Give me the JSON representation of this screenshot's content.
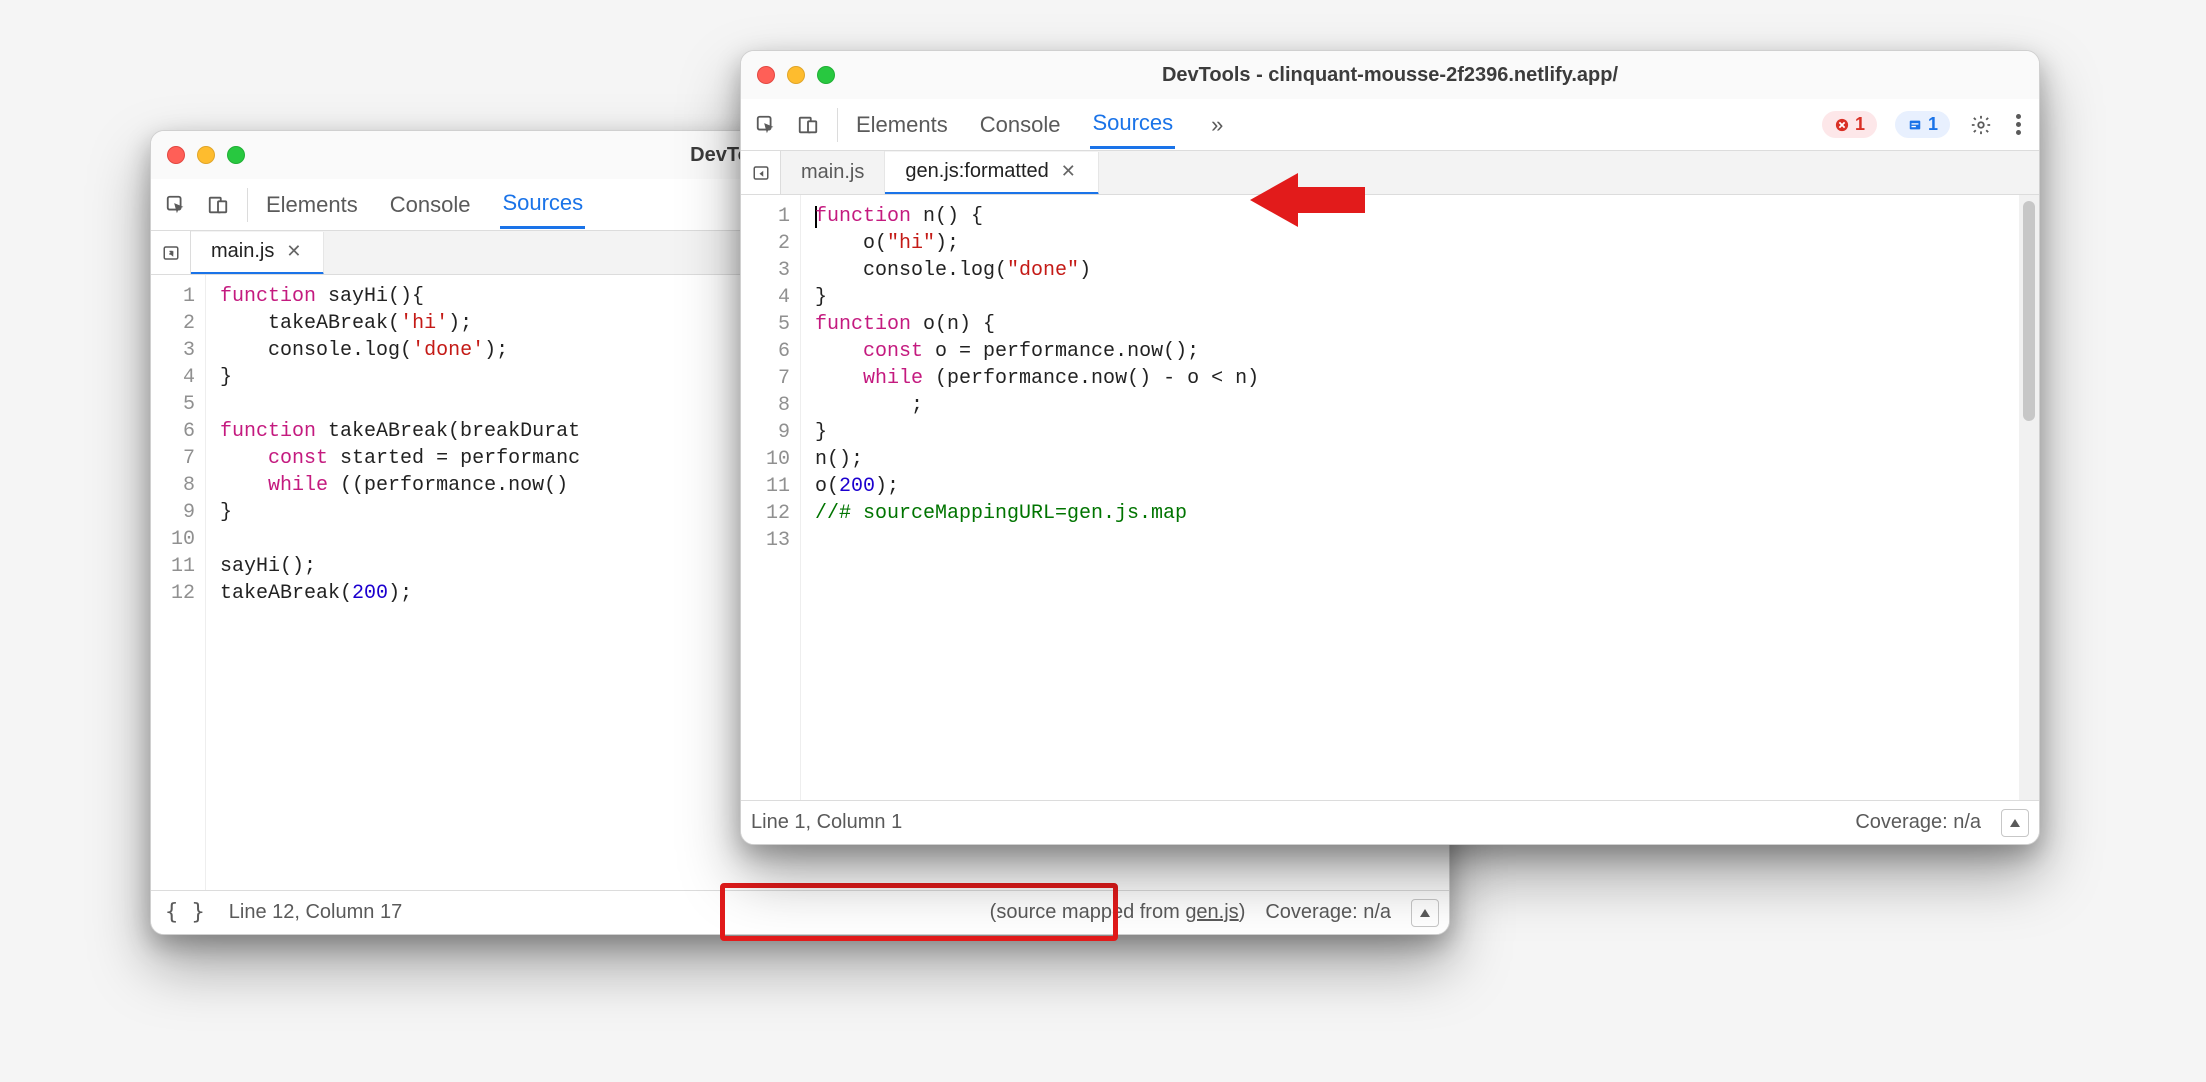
{
  "windowLeft": {
    "title": "DevTools - clinquant-m",
    "panels": [
      "Elements",
      "Console",
      "Sources"
    ],
    "activePanel": 2,
    "fileTab": "main.js",
    "gutter": [
      "1",
      "2",
      "3",
      "4",
      "5",
      "6",
      "7",
      "8",
      "9",
      "10",
      "11",
      "12"
    ],
    "status": {
      "cursor": "Line 12, Column 17",
      "sourceMappedPrefix": "(source mapped from ",
      "sourceMappedLink": "gen.js",
      "sourceMappedSuffix": ")",
      "coverage": "Coverage: n/a"
    }
  },
  "windowRight": {
    "title": "DevTools - clinquant-mousse-2f2396.netlify.app/",
    "panels": [
      "Elements",
      "Console",
      "Sources"
    ],
    "activePanel": 2,
    "badges": {
      "error": "1",
      "info": "1"
    },
    "fileTabs": [
      "main.js",
      "gen.js:formatted"
    ],
    "activeFileTab": 1,
    "gutter": [
      "1",
      "2",
      "3",
      "4",
      "5",
      "6",
      "7",
      "8",
      "9",
      "10",
      "11",
      "12",
      "13"
    ],
    "status": {
      "cursor": "Line 1, Column 1",
      "coverage": "Coverage: n/a"
    }
  },
  "code": {
    "left": {
      "l1_kw": "function",
      "l1_rest": " sayHi(){",
      "l2_ind": "    ",
      "l2_fn": "takeABreak(",
      "l2_str": "'hi'",
      "l2_after": ");",
      "l3_ind": "    ",
      "l3_fn": "console.log(",
      "l3_str": "'done'",
      "l3_after": ");",
      "l4": "}",
      "l5": "",
      "l6_kw": "function",
      "l6_rest": " takeABreak(breakDurat",
      "l7_ind": "    ",
      "l7_kw": "const",
      "l7_rest": " started = performanc",
      "l8_ind": "    ",
      "l8_kw": "while",
      "l8_rest": " ((performance.now() ",
      "l9": "}",
      "l10": "",
      "l11": "sayHi();",
      "l12_a": "takeABreak(",
      "l12_num": "200",
      "l12_b": ");"
    },
    "right": {
      "l1_kw": "function",
      "l1_rest": " n() {",
      "l2_ind": "    ",
      "l2_fn": "o(",
      "l2_str": "\"hi\"",
      "l2_after": ");",
      "l3_ind": "    ",
      "l3_fn": "console.log(",
      "l3_str": "\"done\"",
      "l3_after": ")",
      "l4": "}",
      "l5_kw": "function",
      "l5_rest": " o(n) {",
      "l6_ind": "    ",
      "l6_kw": "const",
      "l6_rest": " o = performance.now();",
      "l7_ind": "    ",
      "l7_kw": "while",
      "l7_rest": " (performance.now() - o < n)",
      "l8": "        ;",
      "l9": "}",
      "l10": "n();",
      "l11_a": "o(",
      "l11_num": "200",
      "l11_b": ");",
      "l12": "//# sourceMappingURL=gen.js.map",
      "l13": ""
    }
  }
}
